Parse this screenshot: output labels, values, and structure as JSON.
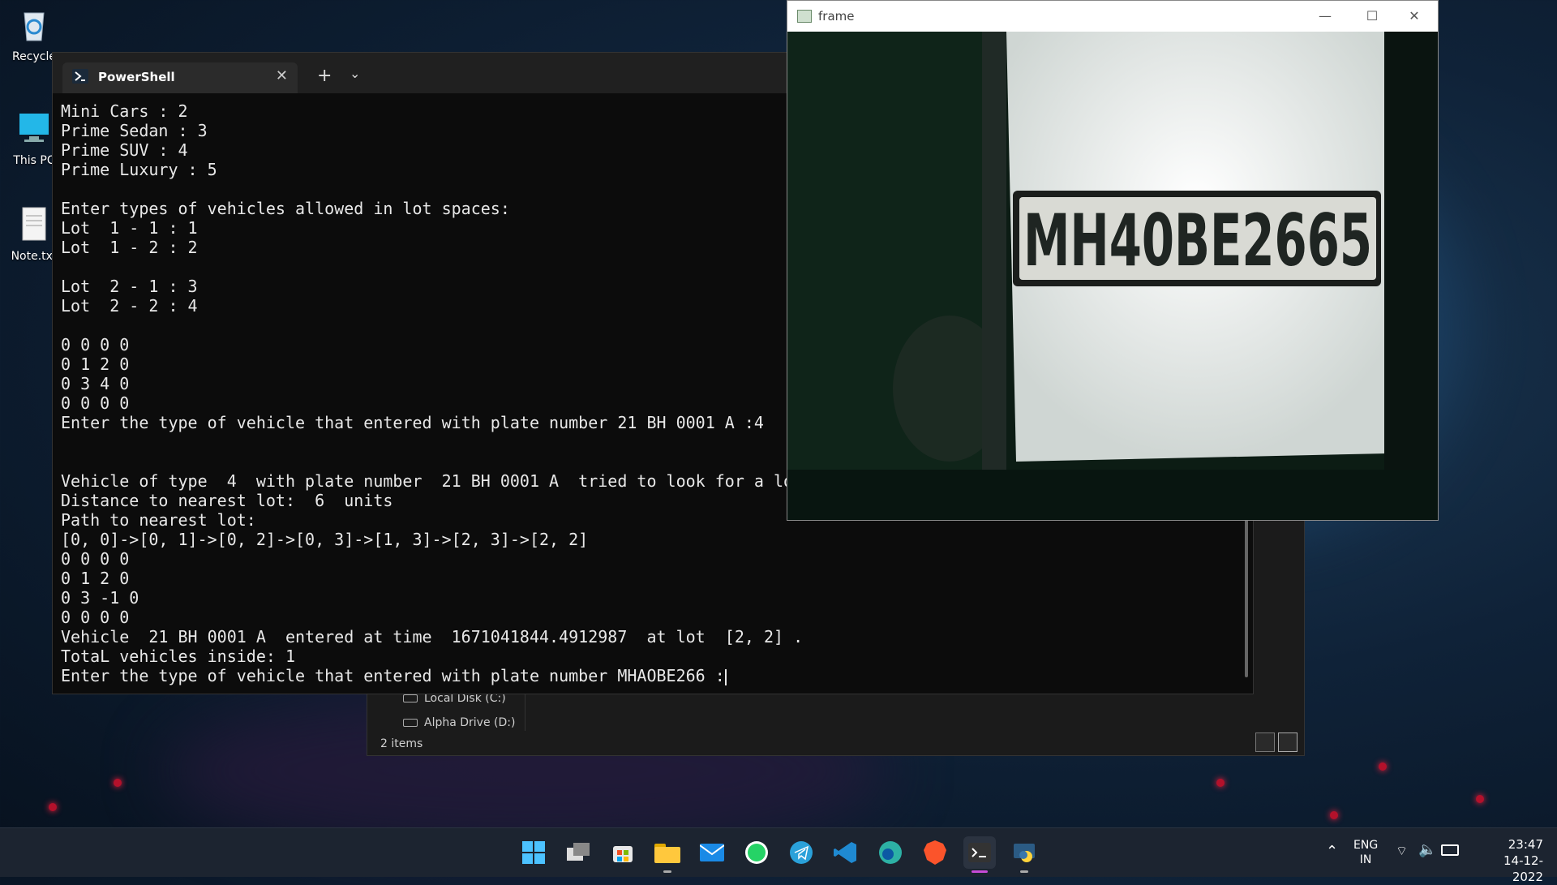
{
  "desktop": {
    "icons": [
      {
        "label": "Recycle"
      },
      {
        "label": "This PC"
      },
      {
        "label": "Note.txt"
      }
    ]
  },
  "terminal": {
    "tab_title": "PowerShell",
    "new_tab": "+",
    "dropdown": "⌄",
    "close": "✕",
    "lines": [
      "Mini Cars : 2",
      "Prime Sedan : 3",
      "Prime SUV : 4",
      "Prime Luxury : 5",
      "",
      "Enter types of vehicles allowed in lot spaces:",
      "Lot  1 - 1 : 1",
      "Lot  1 - 2 : 2",
      "",
      "Lot  2 - 1 : 3",
      "Lot  2 - 2 : 4",
      "",
      "0 0 0 0",
      "0 1 2 0",
      "0 3 4 0",
      "0 0 0 0",
      "Enter the type of vehicle that entered with plate number 21 BH 0001 A :4",
      "",
      "",
      "Vehicle of type  4  with plate number  21 BH 0001 A  tried to look for a lo",
      "Distance to nearest lot:  6  units",
      "Path to nearest lot:",
      "[0, 0]->[0, 1]->[0, 2]->[0, 3]->[1, 3]->[2, 3]->[2, 2]",
      "0 0 0 0",
      "0 1 2 0",
      "0 3 -1 0",
      "0 0 0 0",
      "Vehicle  21 BH 0001 A  entered at time  1671041844.4912987  at lot  [2, 2] .",
      "TotaL vehicles inside: 1"
    ],
    "prompt_line": "Enter the type of vehicle that entered with plate number MHAOBE266 :"
  },
  "explorer": {
    "nav_items": [
      "Local Disk (C:)",
      "Alpha Drive (D:)"
    ],
    "status": "2 items"
  },
  "frame_window": {
    "title": "frame",
    "minimize": "—",
    "maximize": "☐",
    "close": "✕",
    "plate_text": "MH40BE2665"
  },
  "taskbar": {
    "icons": [
      "start-icon",
      "task-view-icon",
      "store-icon",
      "file-explorer-icon",
      "mail-icon",
      "whatsapp-icon",
      "telegram-icon",
      "vscode-icon",
      "edge-icon",
      "brave-icon",
      "terminal-icon",
      "python-icon"
    ],
    "language_top": "ENG",
    "language_bottom": "IN",
    "time": "23:47",
    "date": "14-12-2022"
  },
  "colors": {
    "accent": "#c74bd6",
    "terminal_bg": "#0c0c0c",
    "taskbar_bg": "#1c2430"
  }
}
